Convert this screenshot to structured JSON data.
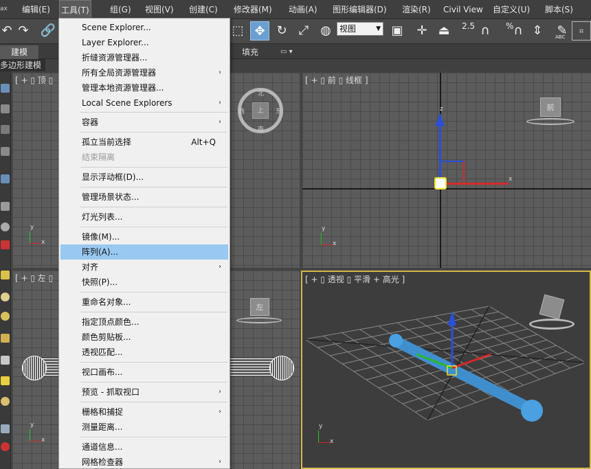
{
  "menubar": {
    "items": [
      {
        "label": "编辑(E)"
      },
      {
        "label": "工具(T)"
      },
      {
        "label": "组(G)"
      },
      {
        "label": "视图(V)"
      },
      {
        "label": "创建(C)"
      },
      {
        "label": "修改器(M)"
      },
      {
        "label": "动画(A)"
      },
      {
        "label": "图形编辑器(D)"
      },
      {
        "label": "渲染(R)"
      },
      {
        "label": "Civil View"
      },
      {
        "label": "自定义(U)"
      },
      {
        "label": "脚本(S)"
      }
    ],
    "logo_fragment": "ax"
  },
  "toolbar": {
    "view_select": "视图",
    "snap_label": "2.5",
    "percent_label": "%",
    "abc_label": "ABC"
  },
  "ribbon": {
    "tab_model": "建模",
    "tab_fill": "填充",
    "subtab": "多边形建模"
  },
  "tools_menu": {
    "items": [
      {
        "label": "Scene Explorer..."
      },
      {
        "label": "Layer Explorer..."
      },
      {
        "label": "折缝资源管理器..."
      },
      {
        "label": "所有全局资源管理器",
        "arrow": "›"
      },
      {
        "label": "管理本地资源管理器..."
      },
      {
        "label": "Local Scene Explorers",
        "arrow": "›"
      },
      {
        "label": "容器",
        "arrow": "›"
      },
      {
        "label": "孤立当前选择",
        "shortcut": "Alt+Q"
      },
      {
        "label": "结束隔离"
      },
      {
        "label": "显示浮动框(D)..."
      },
      {
        "label": "管理场景状态..."
      },
      {
        "label": "灯光列表..."
      },
      {
        "label": "镜像(M)..."
      },
      {
        "label": "阵列(A)..."
      },
      {
        "label": "对齐",
        "arrow": "›"
      },
      {
        "label": "快照(P)..."
      },
      {
        "label": "重命名对象..."
      },
      {
        "label": "指定顶点颜色..."
      },
      {
        "label": "颜色剪贴板..."
      },
      {
        "label": "透视匹配..."
      },
      {
        "label": "视口画布..."
      },
      {
        "label": "预览 - 抓取视口",
        "arrow": "›"
      },
      {
        "label": "栅格和捕捉",
        "arrow": "›"
      },
      {
        "label": "测量距离..."
      },
      {
        "label": "通道信息..."
      },
      {
        "label": "网格检查器",
        "arrow": "›"
      }
    ],
    "highlighted": "阵列(A)...",
    "disabled": [
      "结束隔离"
    ]
  },
  "viewports": {
    "top": {
      "label": "[ + ▯ 顶 ▯"
    },
    "front": {
      "label": "[ + ▯ 前 ▯ 线框 ]",
      "cube": "前",
      "axis_z": "z",
      "axis_x": "x"
    },
    "left": {
      "label": "[ + ▯ 左 ▯",
      "cube": "左"
    },
    "persp": {
      "label": "[ + ▯ 透视 ▯ 平滑 + 高光 ]"
    },
    "compass": {
      "n": "北",
      "s": "南",
      "e": "东",
      "w": "西",
      "cube": "上"
    },
    "gizmo_y": "y",
    "gizmo_x": "x"
  },
  "colors": {
    "menu_highlight": "#99c8f2",
    "persp_border": "#d8b84a",
    "object_blue": "#3f8fcf"
  }
}
